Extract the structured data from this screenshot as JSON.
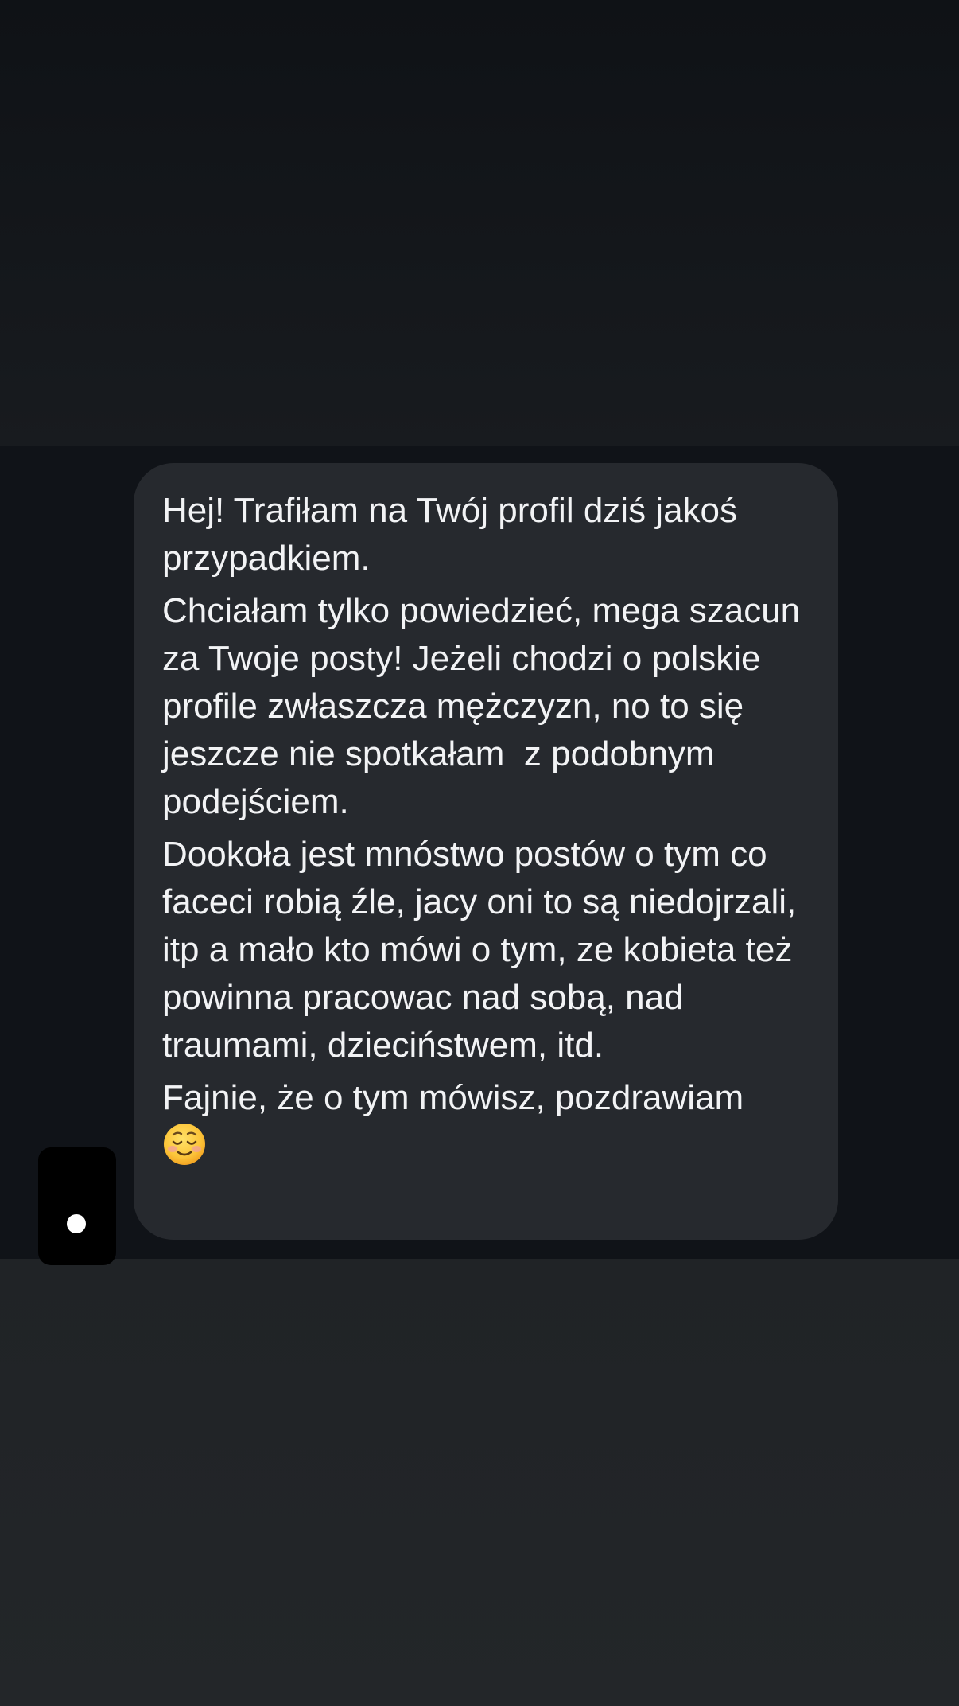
{
  "conversation": {
    "message": {
      "paragraphs": [
        "Hej! Trafiłam na Twój profil dziś jakoś przypadkiem.",
        "Chciałam tylko powiedzieć, mega szacun za Twoje posty! Jeżeli chodzi o polskie profile zwłaszcza mężczyzn, no to się jeszcze nie spotkałam  z podobnym podejściem.",
        "Dookoła jest mnóstwo postów o tym co faceci robią źle, jacy oni to są niedojrzali, itp a mało kto mówi o tym, ze kobieta też powinna pracowac nad sobą, nad traumami, dzieciństwem, itd.",
        "Fajnie, że o tym mówisz, pozdrawiam"
      ],
      "emoji": "smiling-face-icon"
    }
  },
  "colors": {
    "background_top": "#0f1216",
    "background_bottom": "#232629",
    "bubble": "#26292e",
    "text": "#f2f3f5"
  }
}
